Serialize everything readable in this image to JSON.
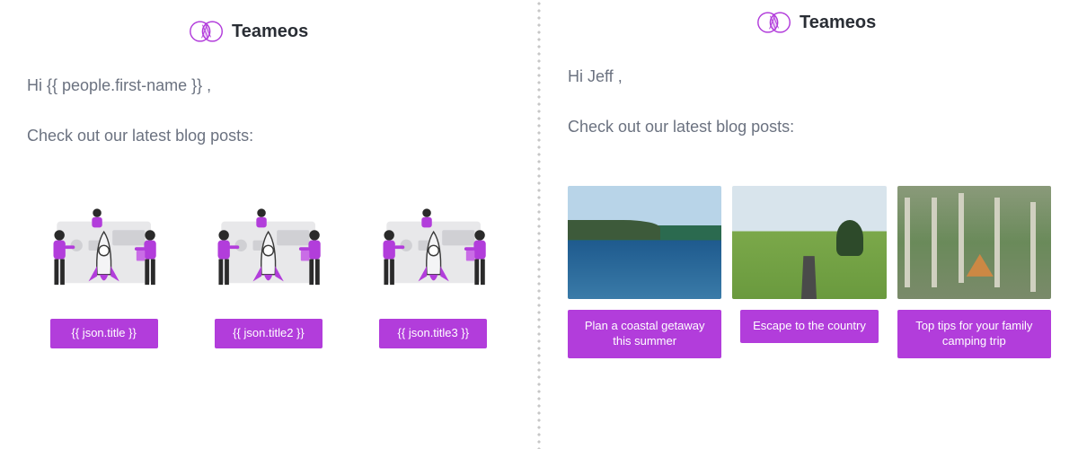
{
  "brand": {
    "name": "Teameos"
  },
  "left": {
    "greeting": "Hi {{ people.first-name }} ,",
    "intro": "Check out our latest blog posts:",
    "cards": [
      {
        "title": "{{ json.title }}"
      },
      {
        "title": "{{ json.title2 }}"
      },
      {
        "title": "{{ json.title3 }}"
      }
    ]
  },
  "right": {
    "greeting": "Hi Jeff ,",
    "intro": "Check out our latest blog posts:",
    "cards": [
      {
        "title": "Plan a coastal getaway this summer"
      },
      {
        "title": "Escape to the country"
      },
      {
        "title": "Top tips for your family camping trip"
      }
    ]
  }
}
